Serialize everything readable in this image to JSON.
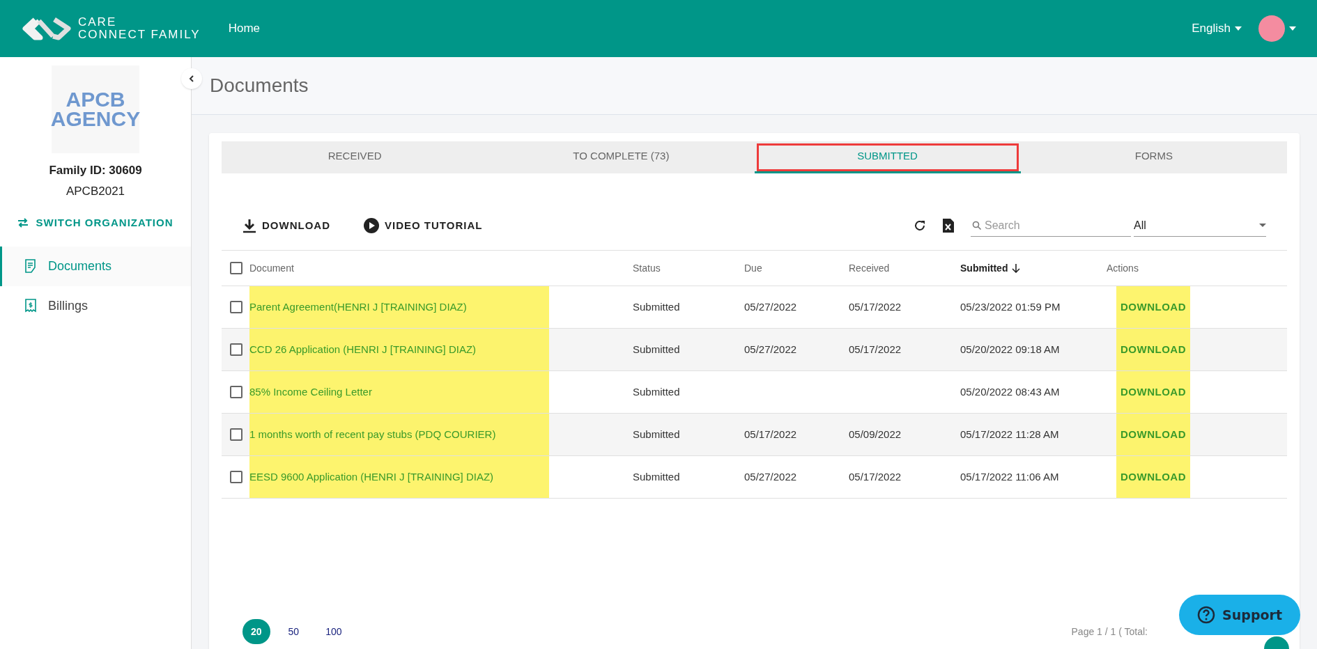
{
  "header": {
    "logo_line1": "CARE",
    "logo_line2": "CONNECT FAMILY",
    "nav": [
      {
        "label": "Home"
      }
    ],
    "language": "English"
  },
  "sidebar": {
    "logo_line1": "APCB",
    "logo_line2": "AGENCY",
    "family_id": "Family ID: 30609",
    "org_code": "APCB2021",
    "switch_label": "SWITCH ORGANIZATION",
    "items": [
      {
        "label": "Documents",
        "kind": "documents",
        "selected": true
      },
      {
        "label": "Billings",
        "kind": "billing",
        "selected": false
      }
    ]
  },
  "page_title": "Documents",
  "tabs": [
    {
      "label": "RECEIVED",
      "selected": false,
      "outlined": false
    },
    {
      "label": "TO COMPLETE (73)",
      "selected": false,
      "outlined": false
    },
    {
      "label": "SUBMITTED",
      "selected": true,
      "outlined": true
    },
    {
      "label": "FORMS",
      "selected": false,
      "outlined": false
    }
  ],
  "toolbar": {
    "download": "DOWNLOAD",
    "video": "VIDEO TUTORIAL",
    "search_placeholder": "Search",
    "filter": "All"
  },
  "table": {
    "columns": [
      {
        "label": "Document",
        "sorted": false
      },
      {
        "label": "Status",
        "sorted": false
      },
      {
        "label": "Due",
        "sorted": false
      },
      {
        "label": "Received",
        "sorted": false
      },
      {
        "label": "Submitted",
        "sorted": true
      },
      {
        "label": "Actions",
        "sorted": false
      }
    ],
    "all_checked": false,
    "rows": [
      {
        "document": "Parent Agreement(HENRI J [TRAINING] DIAZ)",
        "status": "Submitted",
        "due": "05/27/2022",
        "received": "05/17/2022",
        "submitted": "05/23/2022 01:59 PM",
        "action": "DOWNLOAD",
        "checked": false,
        "highlighted": true
      },
      {
        "document": "CCD 26 Application (HENRI J [TRAINING] DIAZ)",
        "status": "Submitted",
        "due": "05/27/2022",
        "received": "05/17/2022",
        "submitted": "05/20/2022 09:18 AM",
        "action": "DOWNLOAD",
        "checked": false,
        "highlighted": true
      },
      {
        "document": "85% Income Ceiling Letter",
        "status": "Submitted",
        "submitted": "05/20/2022 08:43 AM",
        "action": "DOWNLOAD",
        "checked": false,
        "highlighted": true
      },
      {
        "document": "1 months worth of recent pay stubs (PDQ COURIER)",
        "status": "Submitted",
        "due": "05/17/2022",
        "received": "05/09/2022",
        "submitted": "05/17/2022 11:28 AM",
        "action": "DOWNLOAD",
        "checked": false,
        "highlighted": true
      },
      {
        "document": "EESD 9600 Application (HENRI J [TRAINING] DIAZ)",
        "status": "Submitted",
        "due": "05/27/2022",
        "received": "05/17/2022",
        "submitted": "05/17/2022 11:06 AM",
        "action": "DOWNLOAD",
        "checked": false,
        "highlighted": true
      }
    ]
  },
  "pagination": {
    "sizes": [
      {
        "label": "20",
        "selected": true
      },
      {
        "label": "50",
        "selected": false
      },
      {
        "label": "100",
        "selected": false
      }
    ],
    "info": "Page 1 / 1 ( Total:"
  },
  "support": "Support"
}
